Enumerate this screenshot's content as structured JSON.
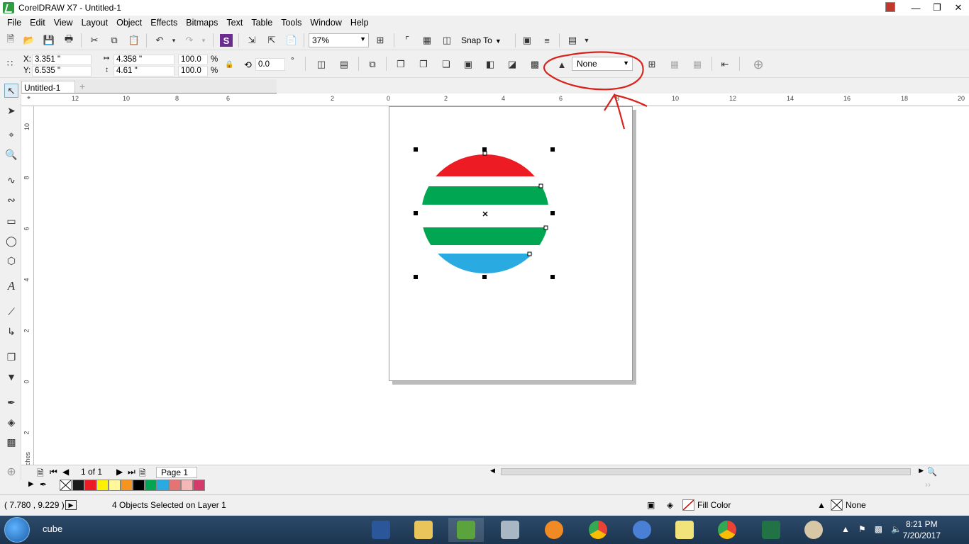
{
  "window": {
    "title": "CorelDRAW X7 - Untitled-1"
  },
  "menu": [
    "File",
    "Edit",
    "View",
    "Layout",
    "Object",
    "Effects",
    "Bitmaps",
    "Text",
    "Table",
    "Tools",
    "Window",
    "Help"
  ],
  "toolbar": {
    "zoom": "37%",
    "snap_to": "Snap To"
  },
  "propbar": {
    "x_label": "X:",
    "x_value": "3.351 \"",
    "y_label": "Y:",
    "y_value": "6.535 \"",
    "w_value": "4.358 \"",
    "h_value": "4.61 \"",
    "scale_w": "100.0",
    "scale_h": "100.0",
    "pct1": "%",
    "pct2": "%",
    "angle": "0.0",
    "degree": "°",
    "outline_width": "None"
  },
  "doc_tab": "Untitled-1",
  "hruler_labels": [
    "12",
    "10",
    "8",
    "6",
    "2",
    "0",
    "2",
    "4",
    "6",
    "8",
    "10",
    "12",
    "14",
    "16",
    "18",
    "20"
  ],
  "vruler_labels": [
    "10",
    "8",
    "6",
    "4",
    "2",
    "0",
    "2"
  ],
  "ruler_units": "inches",
  "page_nav": {
    "counter": "1 of 1",
    "page_label": "Page 1"
  },
  "palette_colors": [
    "#1a1a1a",
    "#ed1c24",
    "#fff200",
    "#fff799",
    "#f7941d",
    "#000000",
    "#00a651",
    "#29abe2",
    "#e57373",
    "#f4b6b6",
    "#d63a6a"
  ],
  "status": {
    "coords": "( 7.780 , 9.229 )",
    "selection": "4 Objects Selected on Layer 1",
    "fill_label": "Fill Color",
    "outline_label": "None"
  },
  "drawing": {
    "stripe_colors": [
      "#ed1c24",
      "#00a651",
      "#ffffff",
      "#00a651",
      "#29abe2"
    ]
  },
  "taskbar": {
    "search_text": "cube",
    "time": "8:21 PM",
    "date": "7/20/2017"
  }
}
